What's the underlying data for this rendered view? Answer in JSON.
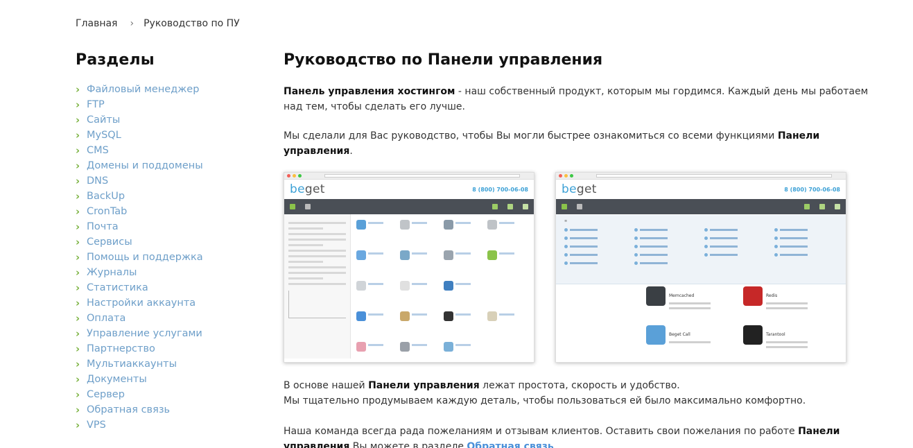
{
  "breadcrumb": {
    "home": "Главная",
    "current": "Руководство по ПУ"
  },
  "sidebar": {
    "title": "Разделы",
    "items": [
      "Файловый менеджер",
      "FTP",
      "Сайты",
      "MySQL",
      "CMS",
      "Домены и поддомены",
      "DNS",
      "BackUp",
      "CronTab",
      "Почта",
      "Сервисы",
      "Помощь и поддержка",
      "Журналы",
      "Статистика",
      "Настройки аккаунта",
      "Оплата",
      "Управление услугами",
      "Партнерство",
      "Мультиаккаунты",
      "Документы",
      "Сервер",
      "Обратная связь",
      "VPS"
    ]
  },
  "content": {
    "title": "Руководство по Панели управления",
    "intro_bold": "Панель управления хостингом",
    "intro_rest": " - наш собственный продукт, которым мы гордимся. Каждый день мы работаем над тем, чтобы сделать его лучше.",
    "guide_text": "Мы сделали для Вас руководство, чтобы Вы могли быстрее ознакомиться со всеми функциями ",
    "guide_bold": "Панели управления",
    "guide_end": ".",
    "base_pre": "В основе нашей ",
    "base_bold": "Панели управления",
    "base_rest": " лежат простота, скорость и удобство.",
    "base_line2": "Мы тщательно продумываем каждую деталь, чтобы пользоваться ей было максимально комфортно.",
    "team_pre": "Наша команда всегда рада пожеланиям и отзывам клиентов. Оставить свои пожелания по работе ",
    "team_bold": "Панели управления",
    "team_mid": " Вы можете в разделе ",
    "team_link": "Обратная связь"
  },
  "screenshots": {
    "logo_a": "be",
    "logo_b": "get",
    "phone": "8 (800) 700-06-08",
    "apps": [
      "Memcached",
      "Redis",
      "Beget Call",
      "Tarantool"
    ]
  },
  "colors": {
    "accent_link": "#6e9fc9",
    "chevron": "#7cb342",
    "brand": "#3da1d6"
  }
}
